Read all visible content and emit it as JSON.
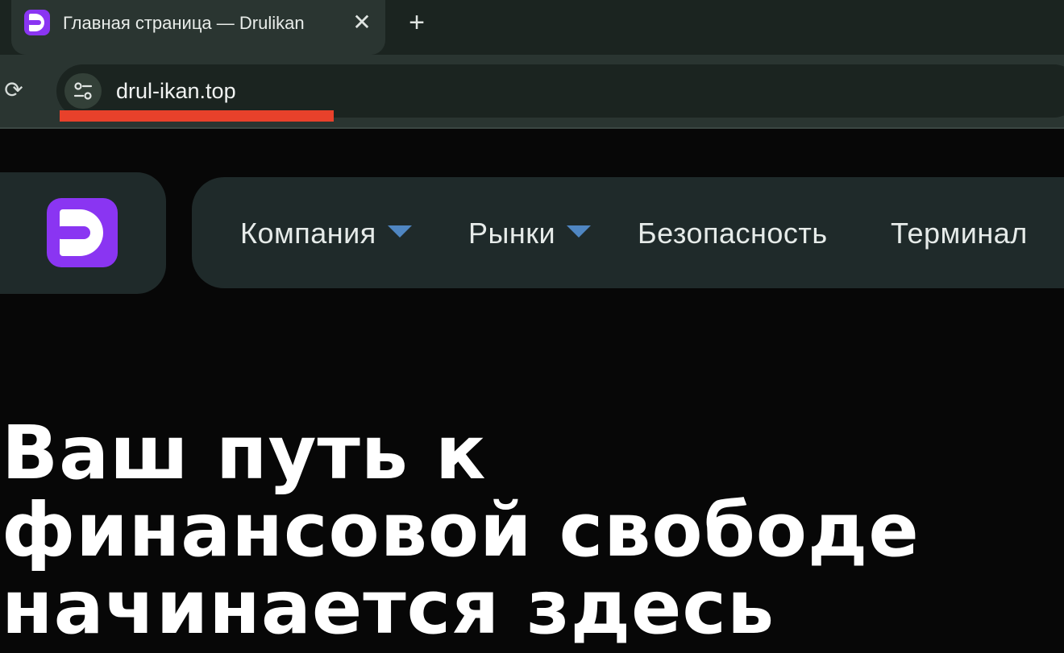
{
  "browser": {
    "tab": {
      "title": "Главная страница — Drulikan",
      "close_glyph": "✕",
      "favicon_icon": "drulikan-logo-icon"
    },
    "new_tab_glyph": "+",
    "reload_glyph": "⟳",
    "address_bar": {
      "url": "drul-ikan.top",
      "site_info_icon": "tune-icon"
    }
  },
  "site": {
    "brand_color": "#8a35f2",
    "logo_icon": "drulikan-logo-icon",
    "nav": {
      "items": [
        {
          "label": "Компания",
          "has_dropdown": true
        },
        {
          "label": "Рынки",
          "has_dropdown": true
        },
        {
          "label": "Безопасность",
          "has_dropdown": false
        },
        {
          "label": "Терминал",
          "has_dropdown": false
        }
      ]
    },
    "hero": {
      "lines": [
        "Ваш путь к",
        "финансовой свободе",
        "начинается здесь"
      ]
    }
  },
  "highlight_color": "#e8412b"
}
